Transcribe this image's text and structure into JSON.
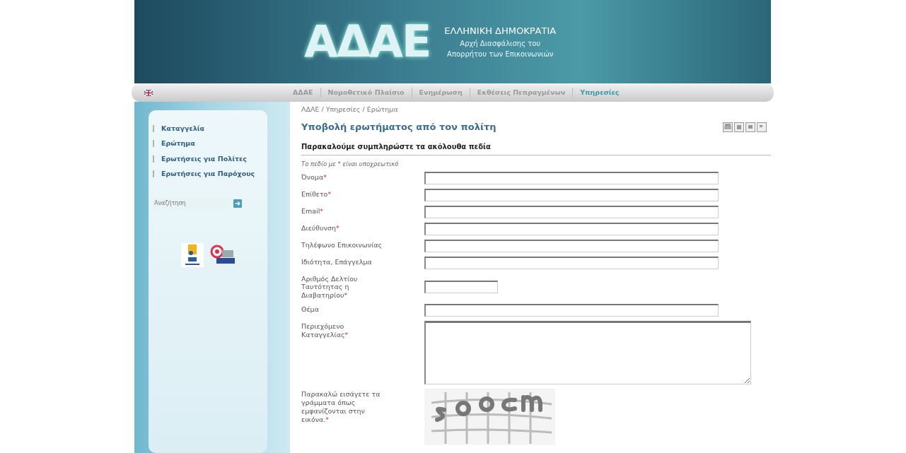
{
  "header": {
    "logo": "ΑΔΑΕ",
    "country": "ΕΛΛΗΝΙΚΗ ΔΗΜΟΚΡΑΤΙΑ",
    "authority_line_1": "Αρχή Διασφάλισης του",
    "authority_line_2": "Απορρήτου των Επικοινωνιών"
  },
  "nav": [
    {
      "label": "ΑΔΑΕ",
      "selected": false
    },
    {
      "label": "Νομοθετικό Πλαίσιο",
      "selected": false
    },
    {
      "label": "Ενημέρωση",
      "selected": false
    },
    {
      "label": "Εκθέσεις Πεπραγμένων",
      "selected": false
    },
    {
      "label": "Υπηρεσίες",
      "selected": true
    }
  ],
  "sidebar": {
    "items": [
      {
        "label": "Καταγγελία"
      },
      {
        "label": "Ερώτημα"
      },
      {
        "label": "Ερωτήσεις για Πολίτες"
      },
      {
        "label": "Ερωτήσεις για Παρόχους"
      }
    ],
    "search": {
      "placeholder": "Αναζήτηση"
    }
  },
  "breadcrumb": "ΑΔΑΕ / Υπηρεσίες / Ερώτημα",
  "page_title": "Υποβολή ερωτήματος από τον πολίτη",
  "form": {
    "heading": "Παρακαλούμε συμπληρώστε τα ακόλουθα πεδία",
    "note": "Το πεδίο με * είναι υποχρεωτικό",
    "fields": [
      {
        "label": "Όνομα",
        "required_mark": "*",
        "kind": "text"
      },
      {
        "label": "Επίθετο",
        "required_mark": "*",
        "kind": "text"
      },
      {
        "label": "Email",
        "required_mark": "*",
        "kind": "text"
      },
      {
        "label": "Διεύθυνση",
        "required_mark": "*",
        "kind": "text"
      },
      {
        "label": "Τηλέφωνο Επικοινωνίας",
        "kind": "text"
      },
      {
        "label": "Ιδιότητα, Επάγγελμα",
        "kind": "text"
      },
      {
        "label": "Αριθμός Δελτίου Ταυτότητας η Διαβατηρίου",
        "required_mark": "*",
        "kind": "short"
      },
      {
        "label": "Θέμα",
        "kind": "text"
      },
      {
        "label": "Περιεχόμενο Καταγγελίας",
        "required_mark": "*",
        "kind": "textarea"
      },
      {
        "label": "Παρακαλώ εισάγετε τα γράμματα όπως εμφανίζονται στην εικόνα.",
        "required_mark": "*",
        "kind": "captcha"
      }
    ]
  }
}
